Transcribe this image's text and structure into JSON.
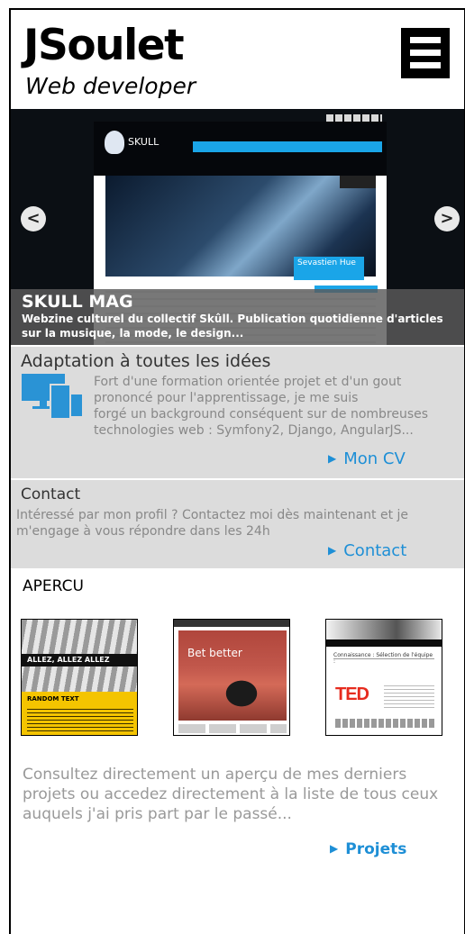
{
  "header": {
    "title": "JSoulet",
    "subtitle": "Web developer",
    "menu_icon": "hamburger-icon"
  },
  "slider": {
    "prev_label": "<",
    "next_label": ">",
    "slide_title": "SKULL MAG",
    "slide_description": "Webzine culturel du collectif Skûll. Publication quotidienne d'articles sur la musique, la mode, le design...",
    "mock_logo_text": "SKULL",
    "mock_caption": "Sevastien Hue"
  },
  "cv_panel": {
    "title": "Adaptation à toutes les idées",
    "icon": "devices-icon",
    "text": "Fort d'une formation orientée projet et d'un gout\nprononcé pour l'apprentissage, je me suis\n forgé un background conséquent sur de nombreuses\ntechnologies web : Symfony2, Django, AngularJS...",
    "link_label": "Mon CV",
    "link_icon": "triangle-right-icon"
  },
  "contact_panel": {
    "title": "Contact",
    "text": "Intéressé par mon profil ? Contactez moi dès maintenant et je m'engage à vous répondre dans les 24h",
    "link_label": "Contact",
    "link_icon": "triangle-right-icon"
  },
  "apercu": {
    "title": "APERCU",
    "thumbnails": [
      {
        "band": "ALLEZ, ALLEZ ALLEZ",
        "head": "RANDOM TEXT"
      },
      {
        "overlay": "Bet better"
      },
      {
        "brand": "TED",
        "head": "Connaissance : Sélection de l'équipe :"
      }
    ],
    "text": "Consultez directement un aperçu de mes derniers projets ou accedez directement à la liste de tous ceux auquels j'ai pris part par le passé...",
    "link_label": "Projets"
  },
  "colors": {
    "accent": "#1e8fd6",
    "panel_bg": "#dcdcdc",
    "muted_text": "#888888"
  }
}
